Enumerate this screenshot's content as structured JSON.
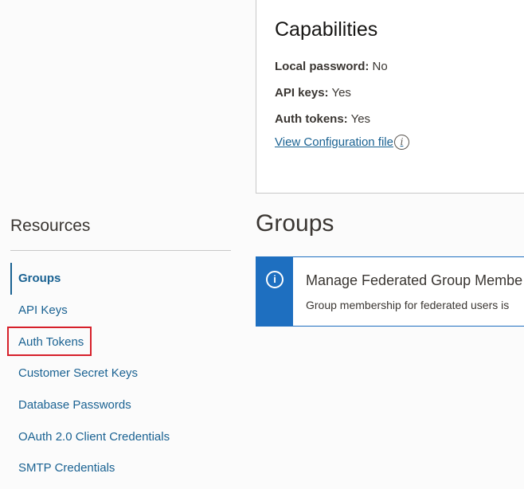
{
  "capabilities": {
    "title": "Capabilities",
    "local_password": {
      "label": "Local password:",
      "value": "No"
    },
    "api_keys": {
      "label": "API keys:",
      "value": "Yes"
    },
    "auth_tokens": {
      "label": "Auth tokens:",
      "value": "Yes"
    },
    "config_link": "View Configuration file",
    "info_icon": "i"
  },
  "resources": {
    "title": "Resources",
    "items": [
      {
        "label": "Groups",
        "active": true
      },
      {
        "label": "API Keys",
        "active": false
      },
      {
        "label": "Auth Tokens",
        "active": false,
        "highlighted": true
      },
      {
        "label": "Customer Secret Keys",
        "active": false
      },
      {
        "label": "Database Passwords",
        "active": false
      },
      {
        "label": "OAuth 2.0 Client Credentials",
        "active": false
      },
      {
        "label": "SMTP Credentials",
        "active": false
      }
    ]
  },
  "groups": {
    "title": "Groups",
    "banner": {
      "icon": "i",
      "title": "Manage Federated Group Membe",
      "text": "Group membership for federated users is"
    }
  },
  "colors": {
    "link": "#1a6292",
    "info_banner": "#1e6fc0",
    "highlight_box": "#d6202a"
  }
}
